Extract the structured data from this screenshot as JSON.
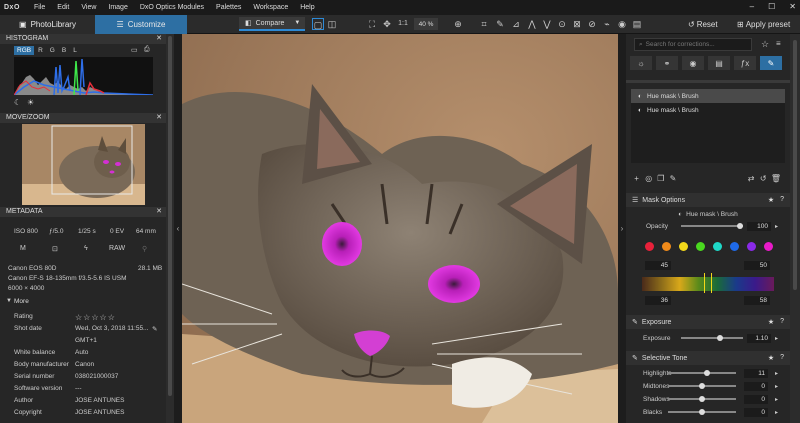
{
  "app": {
    "logo": "DxO"
  },
  "menu": [
    "File",
    "Edit",
    "View",
    "Image",
    "DxO Optics Modules",
    "Palettes",
    "Workspace",
    "Help"
  ],
  "window_controls": [
    "–",
    "☐",
    "✕"
  ],
  "tabs": {
    "library": "PhotoLibrary",
    "customize": "Customize"
  },
  "toolbar": {
    "compare_label": "Compare",
    "one_to_one": "1:1",
    "zoom": "40 %",
    "reset_label": "Reset",
    "apply_preset_label": "Apply preset"
  },
  "histogram": {
    "title": "HISTOGRAM",
    "channels": [
      "RGB",
      "R",
      "G",
      "B",
      "L"
    ],
    "active_channel": "RGB"
  },
  "movezoom": {
    "title": "MOVE/ZOOM"
  },
  "metadata": {
    "title": "METADATA",
    "iso": "ISO 800",
    "aperture": "ƒ/5.0",
    "shutter": "1/25 s",
    "ev": "0 EV",
    "focal": "64 mm",
    "mode": "M",
    "raw": "RAW",
    "camera": "Canon EOS 80D",
    "size": "28.1 MB",
    "lens": "Canon EF-S 18-135mm f/3.5-5.6 IS USM",
    "resolution": "6000 × 4000",
    "more_label": "More",
    "rows": [
      {
        "label": "Rating",
        "value": "☆☆☆☆☆"
      },
      {
        "label": "Shot date",
        "value": "Wed, Oct 3, 2018 11:55..."
      },
      {
        "label": "",
        "value": "GMT+1"
      },
      {
        "label": "White balance",
        "value": "Auto"
      },
      {
        "label": "Body manufacturer",
        "value": "Canon"
      },
      {
        "label": "Serial number",
        "value": "038021000037"
      },
      {
        "label": "Software version",
        "value": "---"
      },
      {
        "label": "Author",
        "value": "JOSE ANTUNES"
      },
      {
        "label": "Copyright",
        "value": "JOSE ANTUNES"
      }
    ]
  },
  "right": {
    "search_placeholder": "Search for corrections...",
    "masks": [
      "Hue mask \\ Brush",
      "Hue mask \\ Brush"
    ],
    "mask_options": {
      "title": "Mask Options",
      "mask_name": "Hue mask \\ Brush",
      "opacity_label": "Opacity",
      "opacity_value": "100",
      "colors": [
        "#e8213a",
        "#f08a1a",
        "#f3d81a",
        "#4ad81f",
        "#1fd8c8",
        "#1f6ae8",
        "#8a2ae8",
        "#e81ac8"
      ],
      "range_left": "45",
      "range_right": "50",
      "range_low": "36",
      "range_high": "58"
    },
    "exposure": {
      "title": "Exposure",
      "label": "Exposure",
      "value": "1.10",
      "level": 0.61
    },
    "selective_tone": {
      "title": "Selective Tone",
      "rows": [
        {
          "label": "Highlights",
          "value": "11",
          "level": 0.55
        },
        {
          "label": "Midtones",
          "value": "0",
          "level": 0.5
        },
        {
          "label": "Shadows",
          "value": "0",
          "level": 0.5
        },
        {
          "label": "Blacks",
          "value": "0",
          "level": 0.5
        }
      ]
    }
  }
}
